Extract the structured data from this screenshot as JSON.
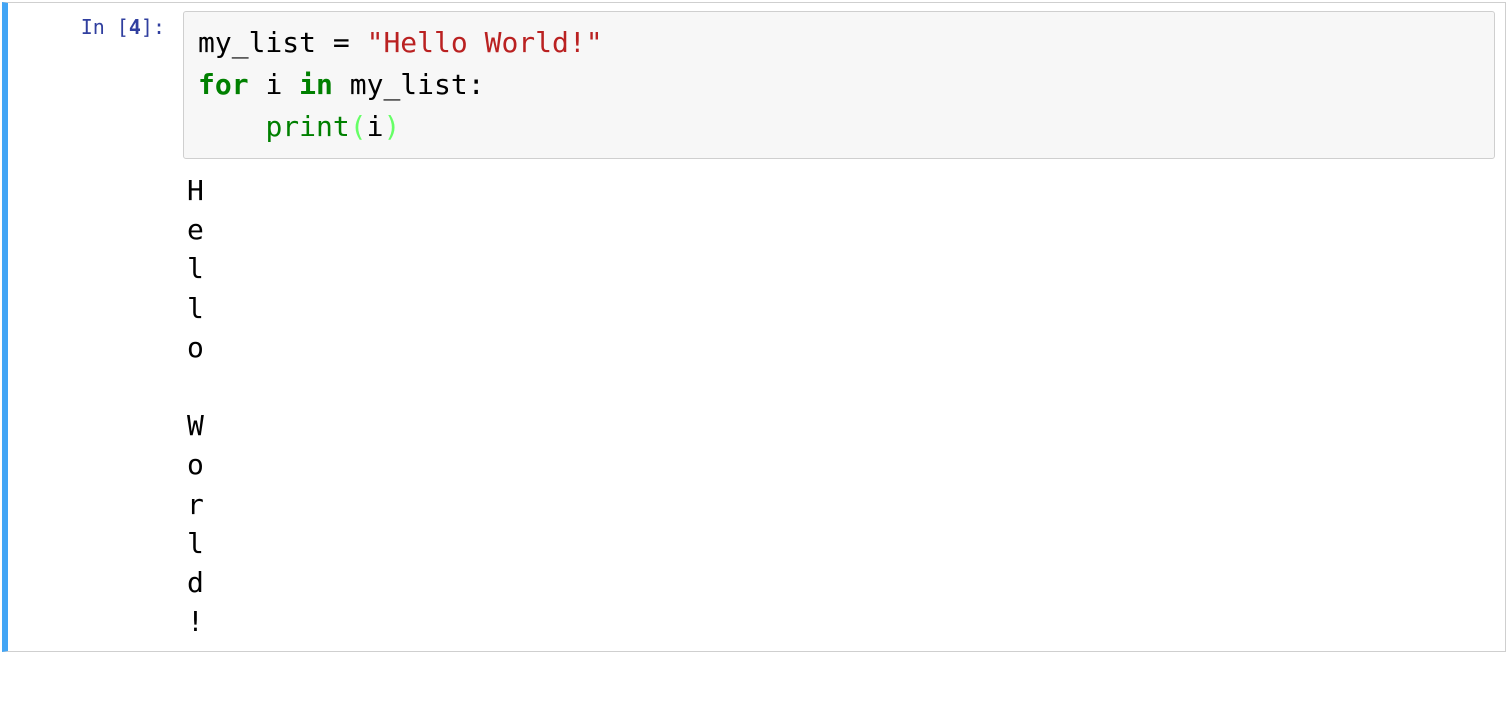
{
  "cell": {
    "prompt": {
      "in_label": "In [",
      "num": "4",
      "close": "]:"
    },
    "code": {
      "line1": {
        "var": "my_list",
        "op": " = ",
        "str": "\"Hello World!\""
      },
      "line2": {
        "kw1": "for",
        "sp1": " ",
        "var1": "i",
        "sp2": " ",
        "kw2": "in",
        "sp3": " ",
        "var2": "my_list",
        "colon": ":"
      },
      "line3": {
        "indent": "    ",
        "fn": "print",
        "lp": "(",
        "arg": "i",
        "rp": ")"
      }
    },
    "output": "H\ne\nl\nl\no\n \nW\no\nr\nl\nd\n!"
  }
}
